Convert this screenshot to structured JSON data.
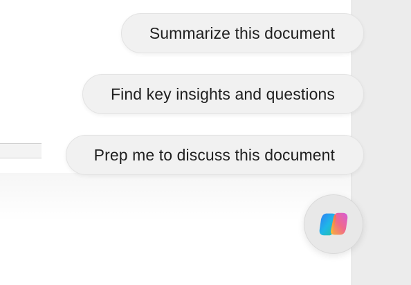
{
  "suggestions": [
    {
      "label": "Summarize this document"
    },
    {
      "label": "Find key insights and questions"
    },
    {
      "label": "Prep me to discuss this document"
    }
  ],
  "copilot_button": {
    "icon": "copilot-logo-icon"
  },
  "colors": {
    "chip_background": "#f1f1f1",
    "chip_text": "#1f1f1f",
    "app_background": "#ececec",
    "document_background": "#ffffff"
  }
}
